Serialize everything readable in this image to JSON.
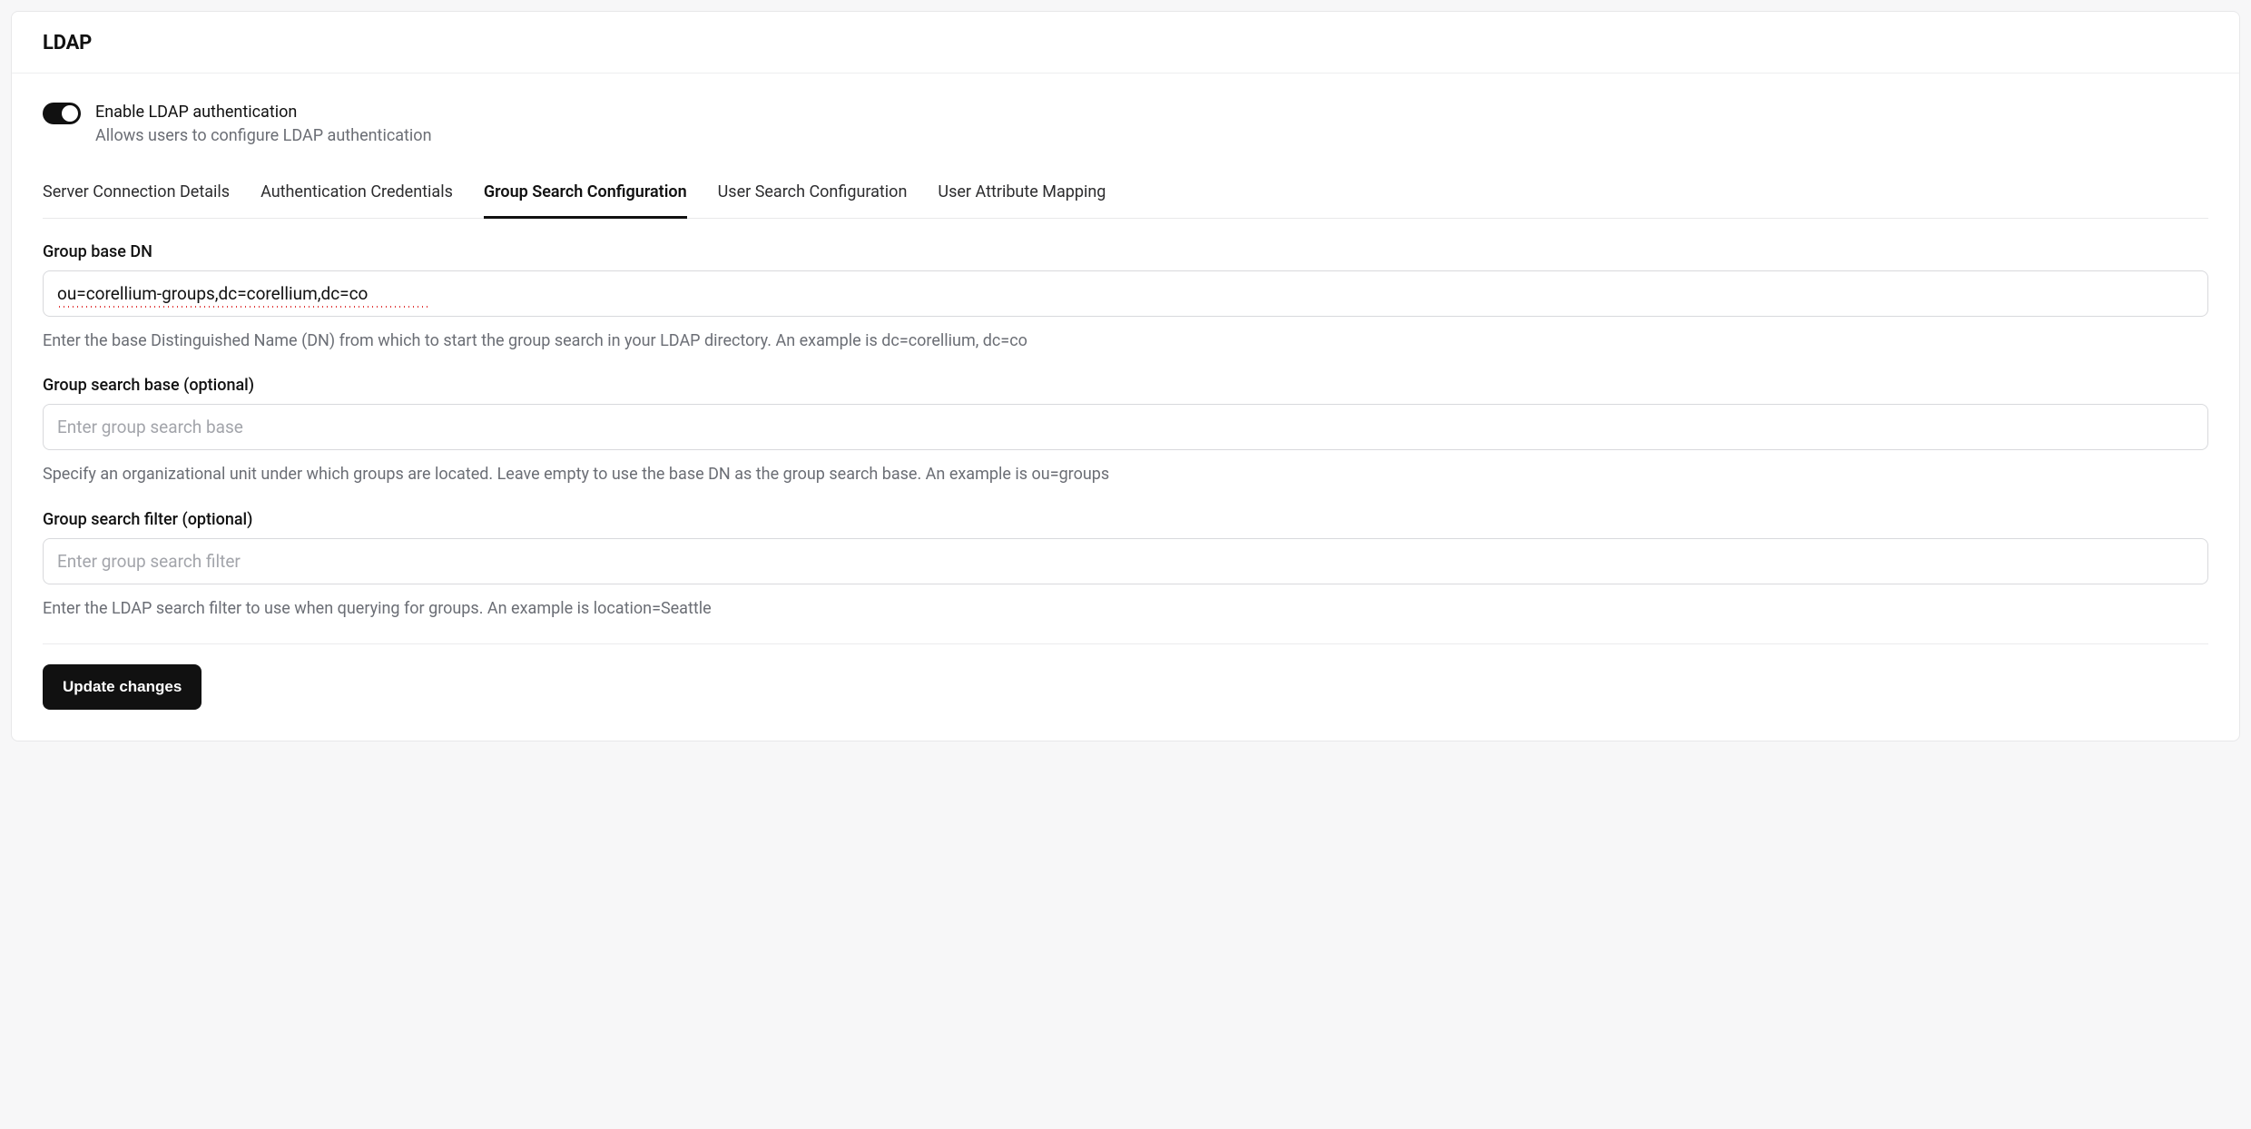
{
  "header": {
    "title": "LDAP"
  },
  "toggle": {
    "title": "Enable LDAP authentication",
    "subtitle": "Allows users to configure LDAP authentication",
    "enabled": true
  },
  "tabs": {
    "items": [
      {
        "label": "Server Connection Details",
        "active": false
      },
      {
        "label": "Authentication Credentials",
        "active": false
      },
      {
        "label": "Group Search Configuration",
        "active": true
      },
      {
        "label": "User Search Configuration",
        "active": false
      },
      {
        "label": "User Attribute Mapping",
        "active": false
      }
    ]
  },
  "fields": {
    "group_base_dn": {
      "label": "Group base DN",
      "value": "ou=corellium-groups,dc=corellium,dc=co",
      "help": "Enter the base Distinguished Name (DN) from which to start the group search in your LDAP directory. An example is dc=corellium, dc=co"
    },
    "group_search_base": {
      "label": "Group search base (optional)",
      "value": "",
      "placeholder": "Enter group search base",
      "help": "Specify an organizational unit under which groups are located. Leave empty to use the base DN as the group search base. An example is ou=groups"
    },
    "group_search_filter": {
      "label": "Group search filter (optional)",
      "value": "",
      "placeholder": "Enter group search filter",
      "help": "Enter the LDAP search filter to use when querying for groups. An example is location=Seattle"
    }
  },
  "actions": {
    "update": "Update changes"
  }
}
